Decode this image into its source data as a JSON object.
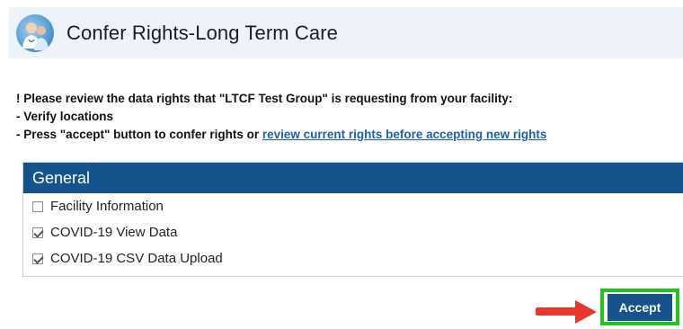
{
  "header": {
    "title": "Confer Rights-Long Term Care",
    "icon": "medical-staff-icon"
  },
  "notice": {
    "line1": "! Please review the data rights that \"LTCF Test Group\" is requesting from your facility:",
    "line2": "- Verify locations",
    "line3_prefix": "- Press \"accept\" button to confer rights or ",
    "line3_link": "review current rights before accepting new rights"
  },
  "panel": {
    "heading": "General",
    "items": [
      {
        "label": "Facility Information",
        "checked": false
      },
      {
        "label": "COVID-19 View Data",
        "checked": true
      },
      {
        "label": "COVID-19 CSV Data Upload",
        "checked": true
      }
    ]
  },
  "actions": {
    "accept_label": "Accept",
    "highlight_color": "#22c41c",
    "arrow_color": "#e8382b"
  },
  "colors": {
    "primary": "#14538c",
    "header_bg": "#eef3fb",
    "link": "#1b5fb3"
  }
}
